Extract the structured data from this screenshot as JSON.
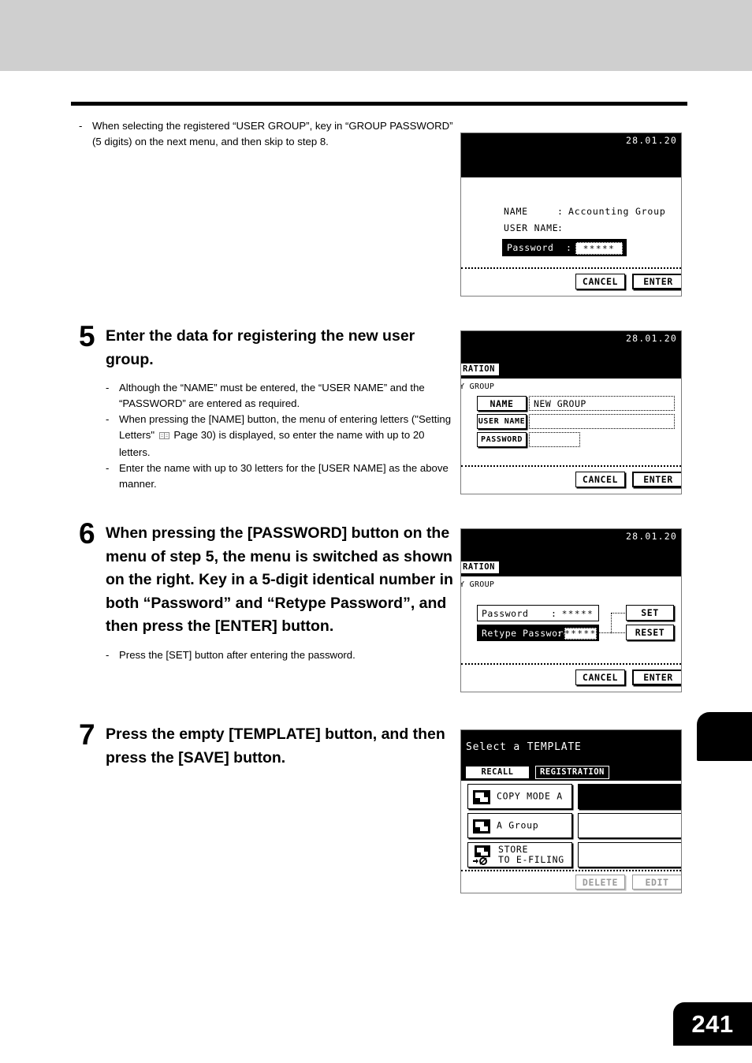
{
  "page": {
    "number": "241"
  },
  "intro_note": {
    "dash": "-",
    "text": "When selecting the registered “USER GROUP”, key in “GROUP PASSWORD” (5 digits) on the next menu, and then skip to step 8."
  },
  "steps": [
    {
      "number": "5",
      "heading": "Enter the data for registering the new user group.",
      "notes": [
        "Although the “NAME” must be entered, the “USER NAME” and the “PASSWORD” are entered as required.",
        "When pressing the [NAME] button, the menu of entering letters (\"Setting Letters\" ",
        "Enter the name with up to 30 letters for the [USER NAME] as the above manner."
      ],
      "note2_tail": " Page 30) is displayed, so enter the name with up to 20 letters."
    },
    {
      "number": "6",
      "heading": "When pressing the [PASSWORD] button on the menu of step 5, the menu is switched as shown on the right. Key in a 5-digit identical number in both “Password” and “Retype Password”, and then press the [ENTER] button.",
      "notes": [
        "Press the [SET] button after entering the password."
      ]
    },
    {
      "number": "7",
      "heading": "Press the empty [TEMPLATE] button, and then press the [SAVE] button.",
      "notes": []
    }
  ],
  "lcd_group_password": {
    "date": "28.01.20",
    "name_label": "NAME",
    "name_colon": ":",
    "name_value": "Accounting Group",
    "username_label": "USER NAME",
    "username_colon": ":",
    "username_value": "",
    "password_label": "Password",
    "password_colon": ":",
    "password_value": "*****",
    "cancel": "CANCEL",
    "enter": "ENTER"
  },
  "lcd_new_group": {
    "date": "28.01.20",
    "tab": "RATION",
    "subtitle": "Y GROUP",
    "name_button": "NAME",
    "name_value": "NEW GROUP",
    "username_button": "USER NAME",
    "username_value": "",
    "password_button": "PASSWORD",
    "password_value": "",
    "cancel": "CANCEL",
    "enter": "ENTER"
  },
  "lcd_password_entry": {
    "date": "28.01.20",
    "tab": "RATION",
    "subtitle": "Y GROUP",
    "password_label": "Password",
    "password_colon": ":",
    "password_value": "*****",
    "retype_label": "Retype Password",
    "retype_colon": ":",
    "retype_value": "*****",
    "set": "SET",
    "reset": "RESET",
    "cancel": "CANCEL",
    "enter": "ENTER"
  },
  "lcd_template": {
    "title": "Select a TEMPLATE",
    "tab_recall": "RECALL",
    "tab_registration": "REGISTRATION",
    "items": [
      {
        "label": "COPY MODE A",
        "icon": "document-icon"
      },
      {
        "label": "A Group",
        "icon": "document-icon"
      },
      {
        "label": "STORE\nTO E-FILING",
        "icon": "document-efiling-icon"
      }
    ],
    "empty_slots": [
      "",
      "",
      ""
    ],
    "delete": "DELETE",
    "edit": "EDIT"
  }
}
